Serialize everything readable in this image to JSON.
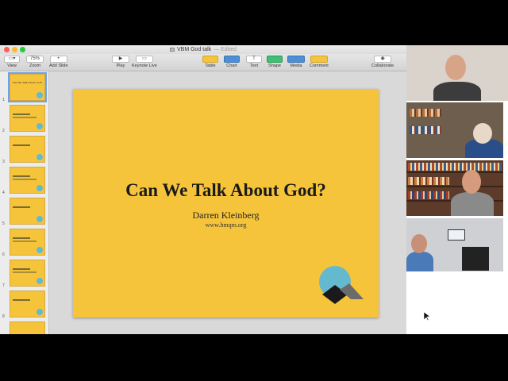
{
  "window": {
    "title": "VBM God talk",
    "edited": "— Edited"
  },
  "toolbar": {
    "view": "View",
    "zoom_value": "75%",
    "zoom": "Zoom",
    "add_slide": "Add Slide",
    "play": "Play",
    "keynote_live": "Keynote Live",
    "table": "Table",
    "chart": "Chart",
    "text": "Text",
    "shape": "Shape",
    "media": "Media",
    "comment": "Comment",
    "collaborate": "Collaborate"
  },
  "navigator": {
    "slides": [
      {
        "number": "1",
        "mini_title": "Can We Talk About God?"
      },
      {
        "number": "2"
      },
      {
        "number": "3"
      },
      {
        "number": "4"
      },
      {
        "number": "5"
      },
      {
        "number": "6"
      },
      {
        "number": "7"
      },
      {
        "number": "8"
      },
      {
        "number": "9"
      }
    ]
  },
  "slide": {
    "title": "Can We Talk About God?",
    "author": "Darren Kleinberg",
    "url": "www.hmqm.org",
    "logo_icon": "teal-circle-logo"
  },
  "colors": {
    "slide_background": "#f6c43b",
    "logo_circle": "#65b9cf",
    "selection": "#6fa3e5"
  },
  "video_panel": {
    "participants": [
      "participant-1",
      "participant-2",
      "participant-3",
      "participant-4"
    ]
  }
}
